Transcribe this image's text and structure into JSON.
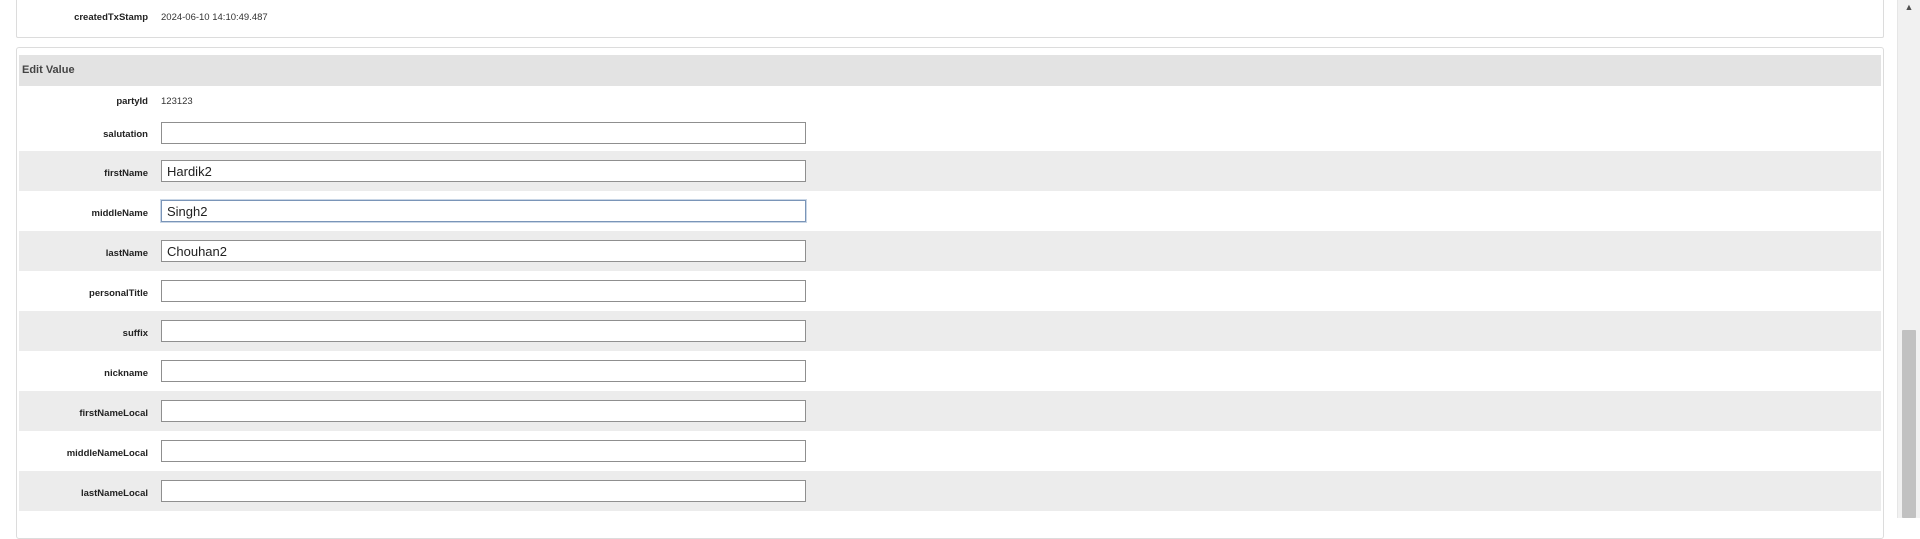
{
  "top_panel": {
    "label": "createdTxStamp",
    "value": "2024-06-10 14:10:49.487"
  },
  "edit_panel": {
    "title": "Edit Value",
    "party_id": {
      "label": "partyId",
      "value": "123123"
    },
    "fields": [
      {
        "label": "salutation",
        "value": "",
        "focused": false
      },
      {
        "label": "firstName",
        "value": "Hardik2",
        "focused": false
      },
      {
        "label": "middleName",
        "value": "Singh2",
        "focused": true
      },
      {
        "label": "lastName",
        "value": "Chouhan2",
        "focused": false
      },
      {
        "label": "personalTitle",
        "value": "",
        "focused": false
      },
      {
        "label": "suffix",
        "value": "",
        "focused": false
      },
      {
        "label": "nickname",
        "value": "",
        "focused": false
      },
      {
        "label": "firstNameLocal",
        "value": "",
        "focused": false
      },
      {
        "label": "middleNameLocal",
        "value": "",
        "focused": false
      },
      {
        "label": "lastNameLocal",
        "value": "",
        "focused": false
      }
    ]
  },
  "scrollbar": {
    "up_arrow": "▲"
  }
}
